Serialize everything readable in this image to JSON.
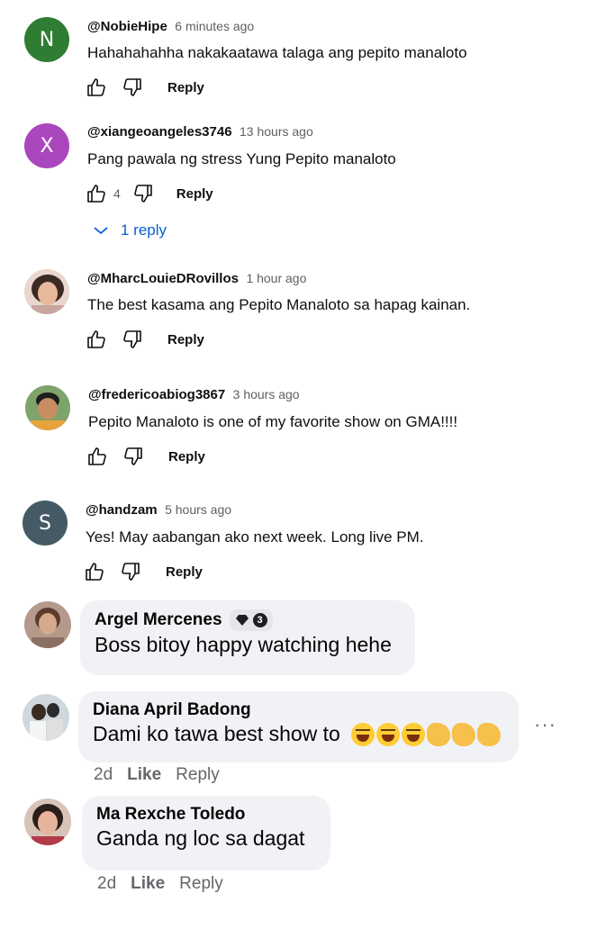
{
  "yt_comments": [
    {
      "avatar_letter": "N",
      "avatar_color": "#2e7d32",
      "handle": "@NobieHipe",
      "time": "6 minutes ago",
      "text": "Hahahahahha nakakaatawa talaga ang pepito manaloto",
      "likes": "",
      "reply_label": "Reply"
    },
    {
      "avatar_letter": "X",
      "avatar_color": "#ab47bc",
      "handle": "@xiangeoangeles3746",
      "time": "13 hours ago",
      "text": "Pang pawala ng stress Yung Pepito manaloto",
      "likes": "4",
      "reply_label": "Reply",
      "replies_toggle": "1 reply"
    },
    {
      "avatar_letter": "",
      "avatar_color": "#d8b7a8",
      "handle": "@MharcLouieDRovillos",
      "time": "1 hour ago",
      "text": "The best kasama ang Pepito Manaloto sa hapag kainan.",
      "likes": "",
      "reply_label": "Reply"
    },
    {
      "avatar_letter": "",
      "avatar_color": "#6b8e5a",
      "handle": "@fredericoabiog3867",
      "time": "3 hours ago",
      "text": "Pepito Manaloto is one of my favorite show on GMA!!!!",
      "likes": "",
      "reply_label": "Reply"
    },
    {
      "avatar_letter": "S",
      "avatar_color": "#455a64",
      "handle": "@handzam",
      "time": "5 hours ago",
      "text": "Yes! May aabangan ako next week. Long live PM.",
      "likes": "",
      "reply_label": "Reply"
    }
  ],
  "fb_comments": [
    {
      "name": "Argel Mercenes",
      "badge_level": "3",
      "text": "Boss bitoy happy watching hehe"
    },
    {
      "name": "Diana April Badong",
      "text": "Dami ko tawa best show to",
      "time": "2d",
      "like_label": "Like",
      "reply_label": "Reply"
    },
    {
      "name": "Ma Rexche Toledo",
      "text": "Ganda ng loc sa dagat",
      "time": "2d",
      "like_label": "Like",
      "reply_label": "Reply"
    }
  ],
  "more_options": "···",
  "icons": {
    "like": "thumbs-up-icon",
    "dislike": "thumbs-down-icon",
    "replies": "chevron-down-icon",
    "badge_heart": "diamond-heart-icon",
    "badge_level": "level-badge-icon",
    "laugh": "tears-of-joy-emoji-icon",
    "clap": "clapping-hands-emoji-icon"
  },
  "colors": {
    "link_blue": "#065fd4",
    "fb_bubble": "#f0f2f5",
    "muted": "#606060"
  }
}
